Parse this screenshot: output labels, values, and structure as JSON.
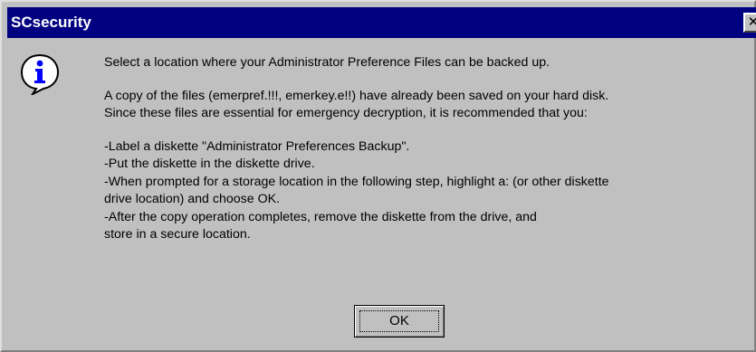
{
  "window": {
    "title": "SCsecurity",
    "close_glyph": "✕",
    "titlebar_color": "#000080",
    "background_color": "#c0c0c0"
  },
  "icon": {
    "name": "info-icon",
    "glyph": "i",
    "color": "#0000ff"
  },
  "message": {
    "line1": "Select a location where your Administrator Preference Files can be backed up.",
    "line2": "A copy of the files (emerpref.!!!, emerkey.e!!) have already been saved on your hard disk.",
    "line3": "Since these files are essential for emergency decryption, it is recommended that you:",
    "step1": "-Label a diskette \"Administrator Preferences Backup\".",
    "step2": "-Put the diskette in the diskette drive.",
    "step3a": "-When prompted for a storage location in the following step, highlight a: (or other diskette",
    "step3b": "drive location) and choose OK.",
    "step4a": "-After the copy operation completes, remove the diskette from the drive, and",
    "step4b": "store in a secure location."
  },
  "buttons": {
    "ok_label": "OK"
  }
}
